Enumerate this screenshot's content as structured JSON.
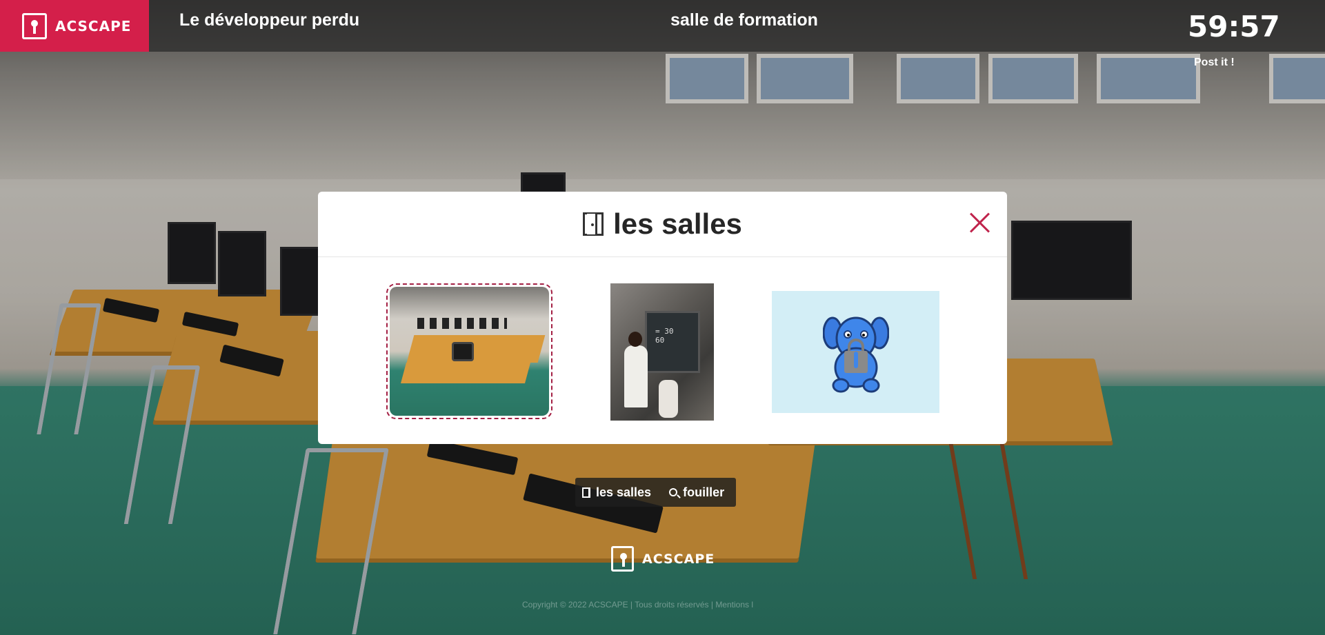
{
  "header": {
    "brand": "ACSCAPE",
    "game_title": "Le développeur perdu",
    "room_title": "salle de formation",
    "timer": "59:57",
    "postit_label": "Post it !"
  },
  "modal": {
    "title": "les salles",
    "icon": "door-icon",
    "close_icon": "close-icon",
    "rooms": [
      {
        "name": "salle de formation",
        "selected": true
      },
      {
        "name": "room-2"
      },
      {
        "name": "room-3-locked"
      }
    ]
  },
  "bottom_nav": {
    "rooms_label": "les salles",
    "search_label": "fouiller"
  },
  "footer": {
    "brand": "ACSCAPE",
    "copyright": "Copyright © 2022 ACSCAPE | Tous droits réservés | Mentions l"
  },
  "colors": {
    "accent": "#d41f4a",
    "selected_border": "#a31f43",
    "locked_bg": "#d3eef6",
    "elephant": "#3a7be0"
  }
}
